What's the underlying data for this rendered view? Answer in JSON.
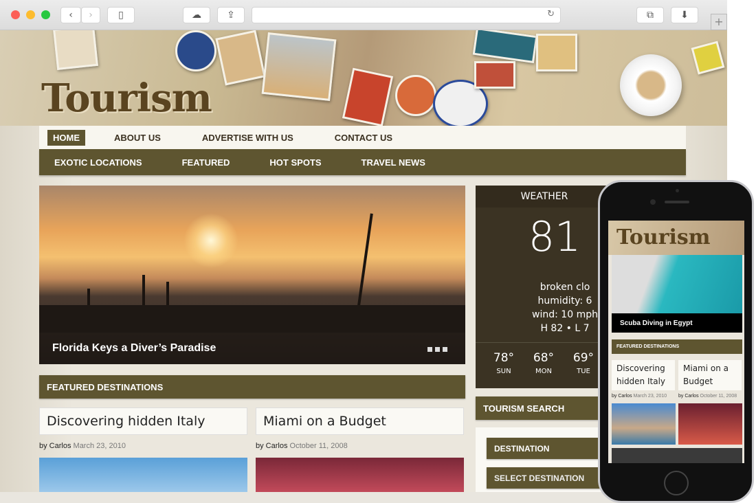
{
  "browser": {
    "url": "",
    "icons": [
      "back-icon",
      "forward-icon",
      "sidebar-icon",
      "cloud-icon",
      "share-icon",
      "reload-icon",
      "tabs-icon",
      "download-icon",
      "new-tab-icon"
    ]
  },
  "site": {
    "logo": "Tourism",
    "top_nav": [
      "HOME",
      "ABOUT US",
      "ADVERTISE WITH US",
      "CONTACT US"
    ],
    "main_nav": [
      "EXOTIC LOCATIONS",
      "FEATURED",
      "HOT SPOTS",
      "TRAVEL NEWS"
    ],
    "slider": {
      "caption": "Florida Keys a Diver’s Paradise"
    },
    "weather": {
      "title": "WEATHER",
      "temp": "81",
      "desc": "broken clo",
      "humidity": "humidity: 6",
      "wind": "wind: 10 mph",
      "hilo": "H 82 • L 7",
      "forecast": [
        {
          "temp": "78°",
          "day": "SUN"
        },
        {
          "temp": "68°",
          "day": "MON"
        },
        {
          "temp": "69°",
          "day": "TUE"
        }
      ]
    },
    "featured": {
      "title": "FEATURED DESTINATIONS",
      "posts": [
        {
          "title": "Discovering hidden Italy",
          "author": "by Carlos",
          "date": "March 23, 2010"
        },
        {
          "title": "Miami on a Budget",
          "author": "by Carlos",
          "date": "October 11, 2008"
        }
      ]
    },
    "search": {
      "title": "TOURISM SEARCH",
      "destination_label": "DESTINATION",
      "select_label": "SELECT DESTINATION"
    }
  },
  "phone": {
    "logo": "Tourism",
    "caption": "Scuba Diving in Egypt",
    "featured_title": "FEATURED DESTINATIONS",
    "posts": [
      {
        "title": "Discovering hidden Italy",
        "author": "by Carlos",
        "date": "March 23, 2010"
      },
      {
        "title": "Miami on a Budget",
        "author": "by Carlos",
        "date": "October 11, 2008"
      }
    ]
  }
}
